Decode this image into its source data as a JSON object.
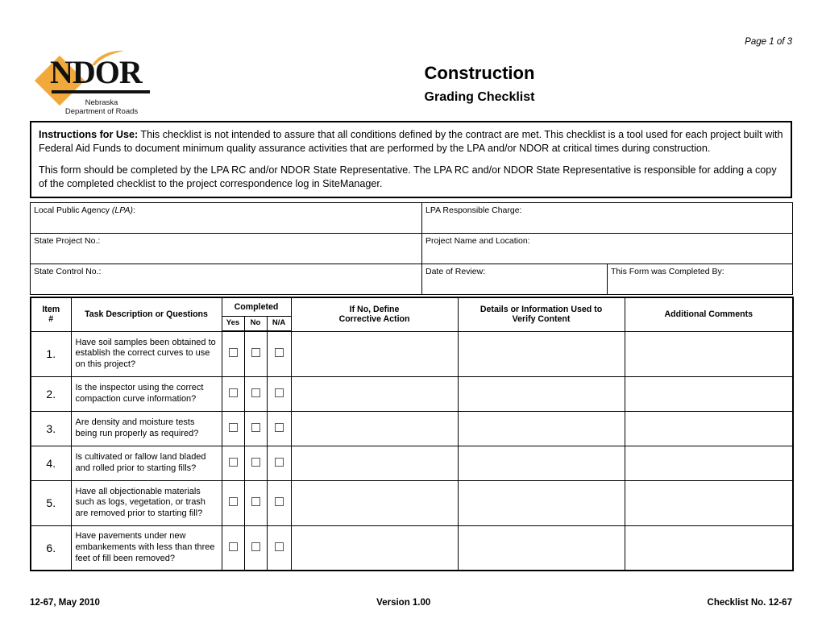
{
  "page_number": "Page 1 of 3",
  "logo": {
    "wordmark": "NDOR",
    "line1": "Nebraska",
    "line2": "Department of Roads",
    "accent_color": "#F2A93B"
  },
  "header": {
    "title": "Construction",
    "subtitle": "Grading Checklist"
  },
  "instructions": {
    "lead_label": "Instructions for Use:",
    "paragraph1": "   This checklist is not intended to assure that all conditions defined by the contract are met. This checklist is a tool used for each project built with Federal Aid Funds to document minimum quality assurance activities that are performed by the LPA and/or NDOR at critical times during construction.",
    "paragraph2": "This form should be completed by the LPA RC and/or NDOR State Representative. The LPA RC and/or NDOR State Representative is responsible for adding a copy of the completed checklist to the project correspondence log in SiteManager."
  },
  "info_fields": {
    "local_public_agency_label": "Local Public Agency ",
    "local_public_agency_italic": "(LPA)",
    "local_public_agency_colon": ":",
    "lpa_responsible_charge": "LPA Responsible Charge:",
    "state_project_no": "State Project No.:",
    "project_name_and_location": "Project Name and Location:",
    "state_control_no": "State Control No.:",
    "date_of_review": "Date of Review:",
    "form_completed_by": "This Form  was Completed By:",
    "values": {
      "local_public_agency": "",
      "lpa_responsible_charge": "",
      "state_project_no": "",
      "project_name_and_location": "",
      "state_control_no": "",
      "date_of_review": "",
      "form_completed_by": ""
    }
  },
  "checklist": {
    "columns": {
      "item": "Item\n#",
      "item_line1": "Item",
      "item_line2": "#",
      "task": "Task Description or Questions",
      "completed_group": "Completed",
      "completed_yes": "Yes",
      "completed_no": "No",
      "completed_na": "N/A",
      "corrective_line1": "If No, Define",
      "corrective_line2": "Corrective Action",
      "details_line1": "Details or Information Used to",
      "details_line2": "Verify Content",
      "additional_comments": "Additional Comments"
    },
    "rows": [
      {
        "number": "1.",
        "task": "Have soil samples been obtained to establish the correct curves to use on this project?",
        "yes": false,
        "no": false,
        "na": false,
        "corrective_action": "",
        "details": "",
        "comments": "",
        "height": "tall"
      },
      {
        "number": "2.",
        "task": "Is the inspector using the correct compaction curve information?",
        "yes": false,
        "no": false,
        "na": false,
        "corrective_action": "",
        "details": "",
        "comments": "",
        "height": "short"
      },
      {
        "number": "3.",
        "task": "Are density and moisture tests being run properly as required?",
        "yes": false,
        "no": false,
        "na": false,
        "corrective_action": "",
        "details": "",
        "comments": "",
        "height": "short"
      },
      {
        "number": "4.",
        "task": "Is cultivated or fallow land bladed and rolled prior to starting fills?",
        "yes": false,
        "no": false,
        "na": false,
        "corrective_action": "",
        "details": "",
        "comments": "",
        "height": "short"
      },
      {
        "number": "5.",
        "task": "Have all objectionable materials such as logs, vegetation, or trash are removed prior to starting fill?",
        "yes": false,
        "no": false,
        "na": false,
        "corrective_action": "",
        "details": "",
        "comments": "",
        "height": "tall"
      },
      {
        "number": "6.",
        "task": "Have pavements under new embankements with less than three feet of fill been removed?",
        "yes": false,
        "no": false,
        "na": false,
        "corrective_action": "",
        "details": "",
        "comments": "",
        "height": "tall"
      }
    ]
  },
  "footer": {
    "left": "12-67, May 2010",
    "center": "Version 1.00",
    "right": "Checklist No. 12-67"
  }
}
